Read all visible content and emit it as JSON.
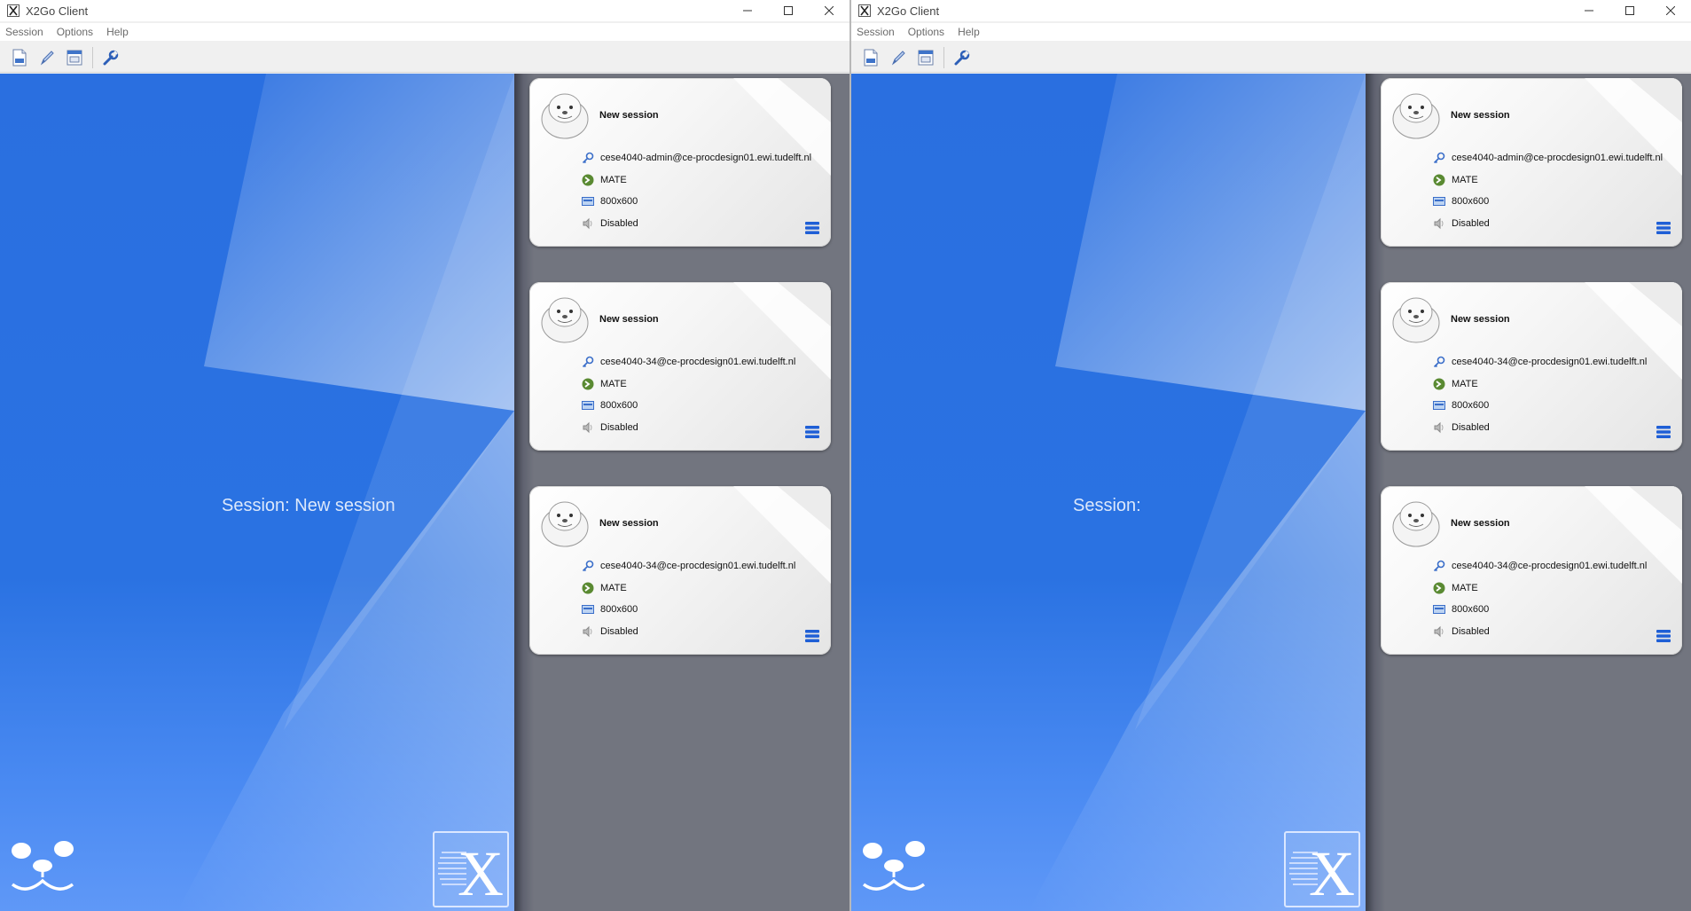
{
  "windows": [
    {
      "title": "X2Go Client",
      "menu": [
        "Session",
        "Options",
        "Help"
      ],
      "session_label": "Session: New session",
      "cards": [
        {
          "name": "New session",
          "host": "cese4040-admin@ce-procdesign01.ewi.tudelft.nl",
          "desktop": "MATE",
          "resolution": "800x600",
          "sound": "Disabled"
        },
        {
          "name": "New session",
          "host": "cese4040-34@ce-procdesign01.ewi.tudelft.nl",
          "desktop": "MATE",
          "resolution": "800x600",
          "sound": "Disabled"
        },
        {
          "name": "New session",
          "host": "cese4040-34@ce-procdesign01.ewi.tudelft.nl",
          "desktop": "MATE",
          "resolution": "800x600",
          "sound": "Disabled"
        }
      ]
    },
    {
      "title": "X2Go Client",
      "menu": [
        "Session",
        "Options",
        "Help"
      ],
      "session_label": "Session:",
      "cards": [
        {
          "name": "New session",
          "host": "cese4040-admin@ce-procdesign01.ewi.tudelft.nl",
          "desktop": "MATE",
          "resolution": "800x600",
          "sound": "Disabled"
        },
        {
          "name": "New session",
          "host": "cese4040-34@ce-procdesign01.ewi.tudelft.nl",
          "desktop": "MATE",
          "resolution": "800x600",
          "sound": "Disabled"
        },
        {
          "name": "New session",
          "host": "cese4040-34@ce-procdesign01.ewi.tudelft.nl",
          "desktop": "MATE",
          "resolution": "800x600",
          "sound": "Disabled"
        }
      ]
    }
  ],
  "icons": {
    "app": "x2go-app-icon",
    "toolbar": [
      "new-session-icon",
      "edit-session-icon",
      "session-management-icon",
      "settings-wrench-icon"
    ],
    "window_controls": [
      "minimize-icon",
      "maximize-icon",
      "close-icon"
    ],
    "card_rows": [
      "key-icon",
      "mate-desktop-icon",
      "display-resolution-icon",
      "sound-icon"
    ],
    "card_menu": "session-menu-icon"
  },
  "colors": {
    "banner_blue": "#2a6fe0",
    "panel_gray": "#72757f",
    "menu_button_blue": "#1f5fd6"
  }
}
